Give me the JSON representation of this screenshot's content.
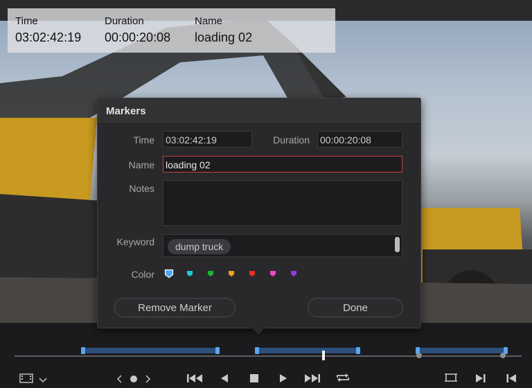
{
  "overlay": {
    "time_label": "Time",
    "time_value": "03:02:42:19",
    "duration_label": "Duration",
    "duration_value": "00:00:20:08",
    "name_label": "Name",
    "name_value": "loading 02"
  },
  "dialog": {
    "title": "Markers",
    "time_label": "Time",
    "time_value": "03:02:42:19",
    "duration_label": "Duration",
    "duration_value": "00:00:20:08",
    "name_label": "Name",
    "name_value": "loading 02",
    "notes_label": "Notes",
    "notes_value": "",
    "keyword_label": "Keyword",
    "keywords": [
      "dump truck"
    ],
    "color_label": "Color",
    "colors": [
      {
        "name": "blue",
        "hex": "#4ea3f0",
        "selected": true
      },
      {
        "name": "cyan",
        "hex": "#19c9d8",
        "selected": false
      },
      {
        "name": "green",
        "hex": "#1fb336",
        "selected": false
      },
      {
        "name": "yellow",
        "hex": "#f0a020",
        "selected": false
      },
      {
        "name": "red",
        "hex": "#e53323",
        "selected": false
      },
      {
        "name": "pink",
        "hex": "#ee48c6",
        "selected": false
      },
      {
        "name": "purple",
        "hex": "#8f3be0",
        "selected": false
      }
    ],
    "remove_button": "Remove Marker",
    "done_button": "Done"
  },
  "icons": {
    "view_mode": "filmstrip-icon",
    "view_mode_dropdown": "chevron-down-icon",
    "jog": [
      "chevron-left-icon",
      "dot-icon",
      "chevron-right-icon"
    ],
    "transport": [
      "first-frame-icon",
      "play-reverse-icon",
      "stop-icon",
      "play-icon",
      "last-frame-icon",
      "loop-icon"
    ],
    "right": [
      "match-frame-icon",
      "next-marker-icon",
      "previous-marker-icon"
    ]
  }
}
